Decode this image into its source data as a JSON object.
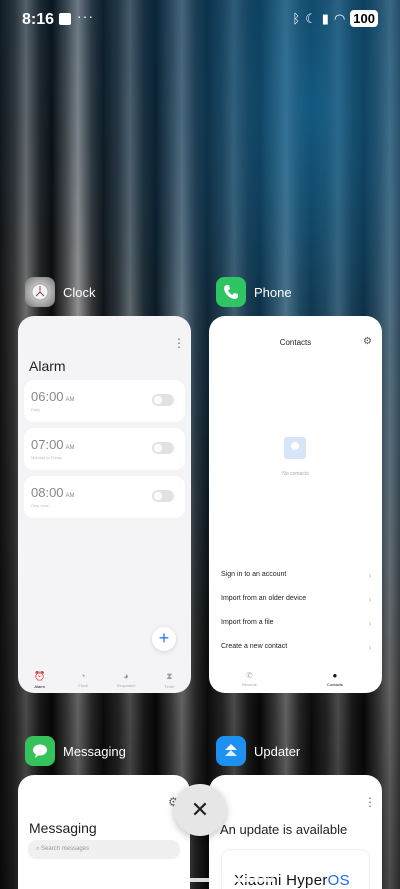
{
  "status_bar": {
    "time": "8:16",
    "more_dots": "···",
    "battery": "100"
  },
  "apps": {
    "clock": {
      "name": "Clock",
      "screen_title": "Alarm",
      "alarms": [
        {
          "time": "06:00",
          "ampm": "AM",
          "sub": "Daily"
        },
        {
          "time": "07:00",
          "ampm": "AM",
          "sub": "Monday to Friday"
        },
        {
          "time": "08:00",
          "ampm": "AM",
          "sub": "Only once"
        }
      ],
      "fab": "+",
      "nav": [
        "Alarm",
        "Clock",
        "Stopwatch",
        "Timer"
      ]
    },
    "phone": {
      "name": "Phone",
      "screen_title": "Contacts",
      "empty_text": "No contacts",
      "links": [
        "Sign in to an account",
        "Import from an older device",
        "Import from a file",
        "Create a new contact"
      ],
      "nav": [
        "Recents",
        "Contacts"
      ]
    },
    "messaging": {
      "name": "Messaging",
      "screen_title": "Messaging",
      "search_placeholder": "Search messages"
    },
    "updater": {
      "name": "Updater",
      "screen_title": "An update is available",
      "brand_prefix": "Xiaomi Hyper",
      "brand_suffix": "OS"
    }
  },
  "close_label": "✕",
  "colors": {
    "phone_icon": "#2fc563",
    "messaging_icon": "#35c25a",
    "updater_icon": "#1e90f0",
    "accent_blue": "#2a7bf6"
  }
}
